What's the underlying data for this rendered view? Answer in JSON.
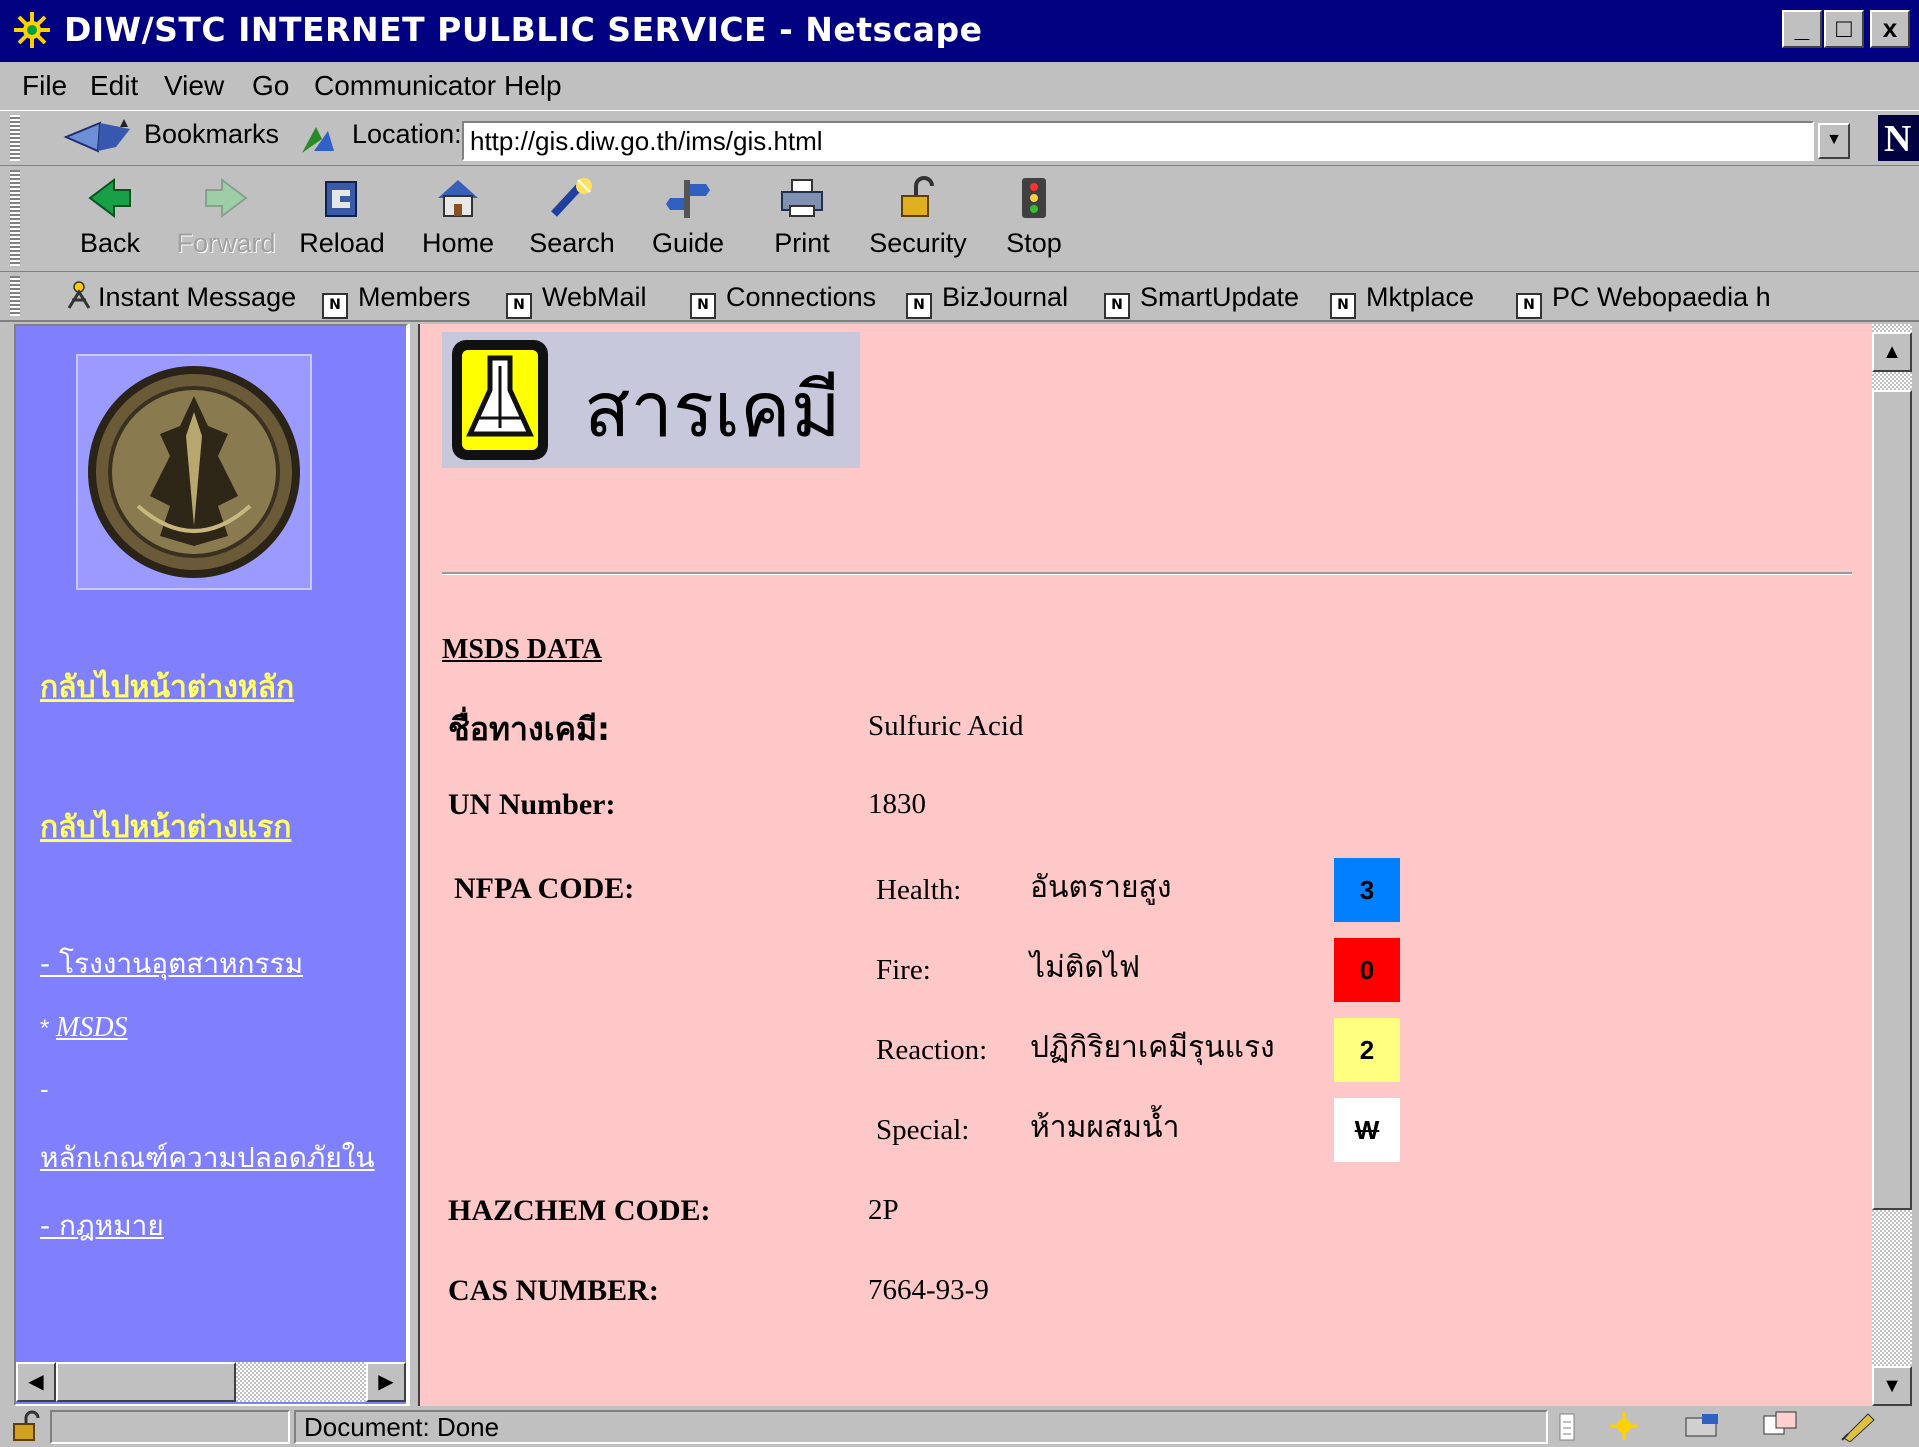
{
  "window": {
    "title": "DIW/STC INTERNET PULBLIC SERVICE - Netscape",
    "controls": [
      "_",
      "□",
      "x"
    ]
  },
  "menu": [
    "File",
    "Edit",
    "View",
    "Go",
    "Communicator",
    "Help"
  ],
  "location_bar": {
    "bookmarks_label": "Bookmarks",
    "location_label": "Location:",
    "url": "http://gis.diw.go.th/ims/gis.html"
  },
  "nav_toolbar": {
    "back": "Back",
    "forward": "Forward",
    "reload": "Reload",
    "home": "Home",
    "search": "Search",
    "guide": "Guide",
    "print": "Print",
    "security": "Security",
    "stop": "Stop"
  },
  "personal_toolbar": [
    "Instant Message",
    "Members",
    "WebMail",
    "Connections",
    "BizJournal",
    "SmartUpdate",
    "Mktplace",
    "PC Webopaedia h"
  ],
  "left_frame": {
    "link_main": "กลับไปหน้าต่างหลัก",
    "link_first": "กลับไปหน้าต่างแรก",
    "link_factory": "- โรงงานอุตสาหกรรม",
    "link_msds_prefix": "*",
    "link_msds": "MSDS",
    "dash": "-",
    "link_safety": "หลักเกณฑ์ความปลอดภัยใน",
    "link_law": "- กฎหมาย"
  },
  "banner": {
    "title": "สารเคมี"
  },
  "msds": {
    "heading": "MSDS DATA",
    "chem_name_label": "ชื่อทางเคมี:",
    "chem_name": "Sulfuric Acid",
    "un_label": "UN Number:",
    "un_value": "1830",
    "nfpa_label": "NFPA CODE:",
    "nfpa": [
      {
        "label": "Health:",
        "desc": "อันตรายสูง",
        "code": "3",
        "color": "#0080ff"
      },
      {
        "label": "Fire:",
        "desc": "ไม่ติดไฟ",
        "code": "0",
        "color": "#ff0000"
      },
      {
        "label": "Reaction:",
        "desc": "ปฏิกิริยาเคมีรุนแรง",
        "code": "2",
        "color": "#ffff80"
      },
      {
        "label": "Special:",
        "desc": "ห้ามผสมน้ำ",
        "code": "W",
        "color": "#ffffff"
      }
    ],
    "hazchem_label": "HAZCHEM CODE:",
    "hazchem_value": "2P",
    "cas_label": "CAS NUMBER:",
    "cas_value": "7664-93-9"
  },
  "status": {
    "text": "Document: Done"
  }
}
